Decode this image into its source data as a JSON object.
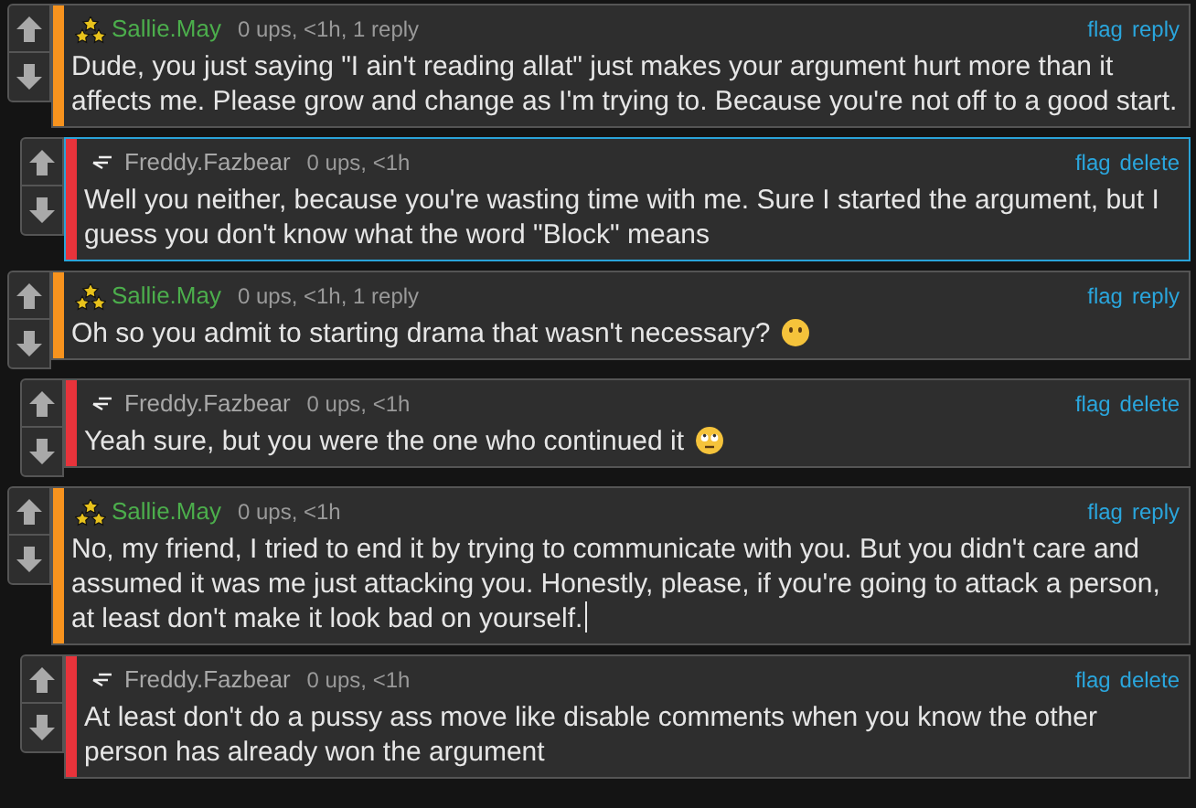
{
  "comments": [
    {
      "kind": "comment",
      "badge": {
        "kind": "stars"
      },
      "author": "Sallie.May",
      "meta": "0 ups, <1h, 1 reply",
      "color": "#f7931e",
      "highlighted": false,
      "actions": [
        "flag",
        "reply"
      ],
      "lines": [
        "Dude, you just saying \"I ain't reading allat\" just makes your argument hurt more than it",
        "affects me. Please grow and change as I'm trying to. Because you're not off to a good start."
      ],
      "text_cursor": false
    },
    {
      "kind": "reply",
      "badge": {
        "kind": "dash"
      },
      "author": "Freddy.Fazbear",
      "meta": "0 ups, <1h",
      "color": "#e8333b",
      "highlighted": true,
      "actions": [
        "flag",
        "delete"
      ],
      "lines": [
        "Well you neither, because you're wasting time with me. Sure I started the argument, but I",
        "guess you don't know what the word \"Block\" means"
      ],
      "text_cursor": false
    },
    {
      "kind": "comment",
      "badge": {
        "kind": "stars"
      },
      "author": "Sallie.May",
      "meta": "0 ups, <1h, 1 reply",
      "color": "#f7931e",
      "highlighted": false,
      "actions": [
        "flag",
        "reply"
      ],
      "lines": [
        "Oh so you admit to starting drama that wasn't necessary?"
      ],
      "emoji": {
        "kind": "no-mouth"
      },
      "text_cursor": false
    },
    {
      "kind": "reply",
      "badge": {
        "kind": "dash"
      },
      "author": "Freddy.Fazbear",
      "meta": "0 ups, <1h",
      "color": "#e8333b",
      "highlighted": false,
      "actions": [
        "flag",
        "delete"
      ],
      "lines": [
        "Yeah sure, but you were the one who continued it"
      ],
      "emoji": {
        "kind": "eye-roll"
      },
      "text_cursor": false
    },
    {
      "kind": "comment",
      "badge": {
        "kind": "stars"
      },
      "author": "Sallie.May",
      "meta": "0 ups, <1h",
      "color": "#f7931e",
      "highlighted": false,
      "actions": [
        "flag",
        "reply"
      ],
      "lines": [
        "No, my friend, I tried to end it by trying to communicate with you. But you didn't care and",
        "assumed it was me just attacking you. Honestly, please, if you're going to attack a person,",
        "at least don't make it look bad on yourself."
      ],
      "text_cursor": true
    },
    {
      "kind": "reply",
      "badge": {
        "kind": "dash"
      },
      "author": "Freddy.Fazbear",
      "meta": "0 ups, <1h",
      "color": "#e8333b",
      "highlighted": false,
      "actions": [
        "flag",
        "delete"
      ],
      "lines": [
        "At least don't do a pussy ass move like disable comments when you know the other",
        "person has already won the argument"
      ],
      "text_cursor": false
    }
  ]
}
